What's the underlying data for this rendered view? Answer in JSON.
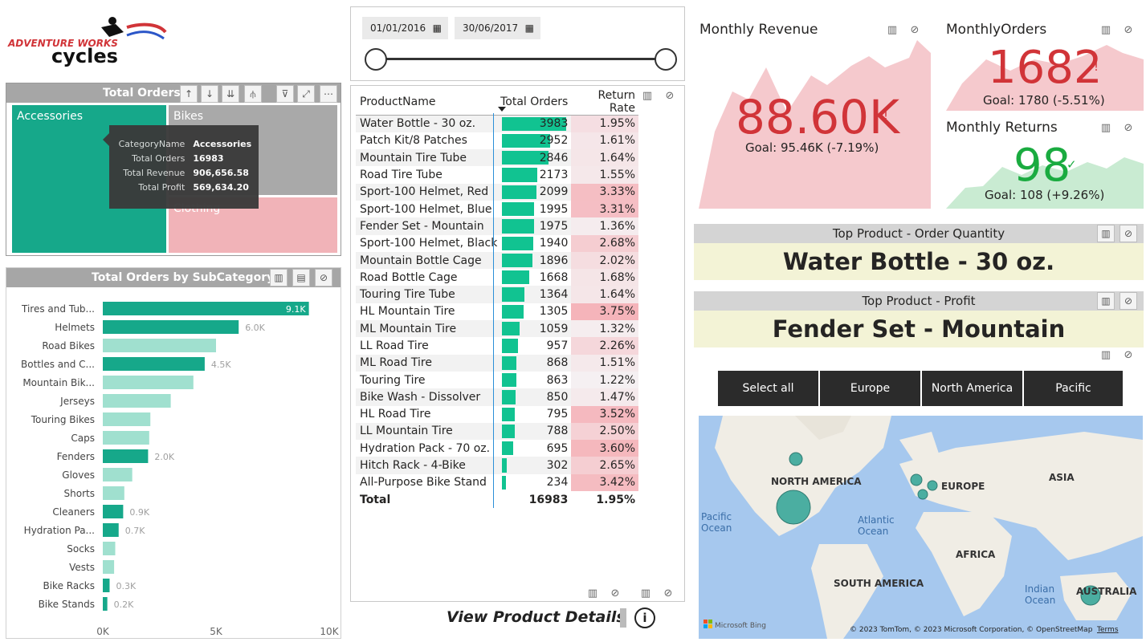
{
  "logo": {
    "line1": "ADVENTURE WORKS",
    "line2": "cycles"
  },
  "treemap": {
    "title": "Total Orders b",
    "cells": [
      {
        "label": "Accessories",
        "color": "#16a88a"
      },
      {
        "label": "Bikes",
        "color": "#a9a9a9"
      },
      {
        "label": "Clothing",
        "color": "#f1b3b8"
      }
    ],
    "tooltip": {
      "rows": [
        {
          "k": "CategoryName",
          "v": "Accessories"
        },
        {
          "k": "Total Orders",
          "v": "16983"
        },
        {
          "k": "Total Revenue",
          "v": "906,656.58"
        },
        {
          "k": "Total Profit",
          "v": "569,634.20"
        }
      ]
    }
  },
  "subcat": {
    "title": "Total Orders by SubCategory",
    "chart_data": {
      "type": "bar",
      "orientation": "horizontal",
      "title": "Total Orders by SubCategory",
      "categories": [
        "Tires and Tub...",
        "Helmets",
        "Road Bikes",
        "Bottles and C...",
        "Mountain Bik...",
        "Jerseys",
        "Touring Bikes",
        "Caps",
        "Fenders",
        "Gloves",
        "Shorts",
        "Cleaners",
        "Hydration Pa...",
        "Socks",
        "Vests",
        "Bike Racks",
        "Bike Stands"
      ],
      "values": [
        9100,
        6000,
        5000,
        4500,
        4000,
        3000,
        2100,
        2050,
        2000,
        1300,
        950,
        900,
        700,
        550,
        500,
        300,
        200
      ],
      "data_labels": [
        "9.1K",
        "6.0K",
        "",
        "4.5K",
        "",
        "",
        "",
        "",
        "2.0K",
        "",
        "",
        "0.9K",
        "0.7K",
        "",
        "",
        "0.3K",
        "0.2K"
      ],
      "highlighted": [
        true,
        true,
        false,
        true,
        false,
        false,
        false,
        false,
        true,
        false,
        false,
        true,
        true,
        false,
        false,
        true,
        true
      ],
      "xlim": [
        0,
        10000
      ],
      "xticks": [
        "0K",
        "5K",
        "10K"
      ],
      "color_highlight": "#16a88a",
      "color_dim": "#a0e0cf"
    }
  },
  "dates": {
    "start": "01/01/2016",
    "end": "30/06/2017"
  },
  "table": {
    "headers": {
      "name": "ProductName",
      "orders": "Total Orders",
      "rate": "Return Rate"
    },
    "max_orders": 3983,
    "rows": [
      {
        "name": "Water Bottle - 30 oz.",
        "orders": "3983",
        "rate": "1.95%",
        "o": 3983,
        "r": 1.95
      },
      {
        "name": "Patch Kit/8 Patches",
        "orders": "2952",
        "rate": "1.61%",
        "o": 2952,
        "r": 1.61
      },
      {
        "name": "Mountain Tire Tube",
        "orders": "2846",
        "rate": "1.64%",
        "o": 2846,
        "r": 1.64
      },
      {
        "name": "Road Tire Tube",
        "orders": "2173",
        "rate": "1.55%",
        "o": 2173,
        "r": 1.55
      },
      {
        "name": "Sport-100 Helmet, Red",
        "orders": "2099",
        "rate": "3.33%",
        "o": 2099,
        "r": 3.33
      },
      {
        "name": "Sport-100 Helmet, Blue",
        "orders": "1995",
        "rate": "3.31%",
        "o": 1995,
        "r": 3.31
      },
      {
        "name": "Fender Set - Mountain",
        "orders": "1975",
        "rate": "1.36%",
        "o": 1975,
        "r": 1.36
      },
      {
        "name": "Sport-100 Helmet, Black",
        "orders": "1940",
        "rate": "2.68%",
        "o": 1940,
        "r": 2.68
      },
      {
        "name": "Mountain Bottle Cage",
        "orders": "1896",
        "rate": "2.02%",
        "o": 1896,
        "r": 2.02
      },
      {
        "name": "Road Bottle Cage",
        "orders": "1668",
        "rate": "1.68%",
        "o": 1668,
        "r": 1.68
      },
      {
        "name": "Touring Tire Tube",
        "orders": "1364",
        "rate": "1.64%",
        "o": 1364,
        "r": 1.64
      },
      {
        "name": "HL Mountain Tire",
        "orders": "1305",
        "rate": "3.75%",
        "o": 1305,
        "r": 3.75
      },
      {
        "name": "ML Mountain Tire",
        "orders": "1059",
        "rate": "1.32%",
        "o": 1059,
        "r": 1.32
      },
      {
        "name": "LL Road Tire",
        "orders": "957",
        "rate": "2.26%",
        "o": 957,
        "r": 2.26
      },
      {
        "name": "ML Road Tire",
        "orders": "868",
        "rate": "1.51%",
        "o": 868,
        "r": 1.51
      },
      {
        "name": "Touring Tire",
        "orders": "863",
        "rate": "1.22%",
        "o": 863,
        "r": 1.22
      },
      {
        "name": "Bike Wash - Dissolver",
        "orders": "850",
        "rate": "1.47%",
        "o": 850,
        "r": 1.47
      },
      {
        "name": "HL Road Tire",
        "orders": "795",
        "rate": "3.52%",
        "o": 795,
        "r": 3.52
      },
      {
        "name": "LL Mountain Tire",
        "orders": "788",
        "rate": "2.50%",
        "o": 788,
        "r": 2.5
      },
      {
        "name": "Hydration Pack - 70 oz.",
        "orders": "695",
        "rate": "3.60%",
        "o": 695,
        "r": 3.6
      },
      {
        "name": "Hitch Rack - 4-Bike",
        "orders": "302",
        "rate": "2.65%",
        "o": 302,
        "r": 2.65
      },
      {
        "name": "All-Purpose Bike Stand",
        "orders": "234",
        "rate": "3.42%",
        "o": 234,
        "r": 3.42
      }
    ],
    "total": {
      "label": "Total",
      "orders": "16983",
      "rate": "1.95%"
    }
  },
  "view_details": "View Product Details",
  "kpi": {
    "revenue": {
      "title": "Monthly Revenue",
      "value": "88.60K",
      "mark": "!",
      "goal": "Goal: 95.46K (-7.19%)",
      "color": "#d13438"
    },
    "orders": {
      "title": "MonthlyOrders",
      "value": "1682",
      "mark": "!",
      "goal": "Goal: 1780 (-5.51%)",
      "color": "#d13438"
    },
    "returns": {
      "title": "Monthly Returns",
      "value": "98",
      "mark": "✓",
      "goal": "Goal: 108 (+9.26%)",
      "color": "#1aab40"
    }
  },
  "top_qty": {
    "title": "Top Product - Order Quantity",
    "value": "Water Bottle - 30 oz."
  },
  "top_profit": {
    "title": "Top Product - Profit",
    "value": "Fender Set - Mountain"
  },
  "regions": [
    "Select all",
    "Europe",
    "North America",
    "Pacific"
  ],
  "map": {
    "labels": {
      "na": "NORTH AMERICA",
      "eu": "EUROPE",
      "asia": "ASIA",
      "africa": "AFRICA",
      "sa": "SOUTH AMERICA",
      "au": "AUSTRALIA",
      "pacific": "Pacific\nOcean",
      "atlantic": "Atlantic\nOcean",
      "indian": "Indian\nOcean"
    },
    "bing": "Microsoft Bing",
    "credits": "© 2023 TomTom, © 2023 Microsoft Corporation, © OpenStreetMap",
    "terms": "Terms"
  }
}
